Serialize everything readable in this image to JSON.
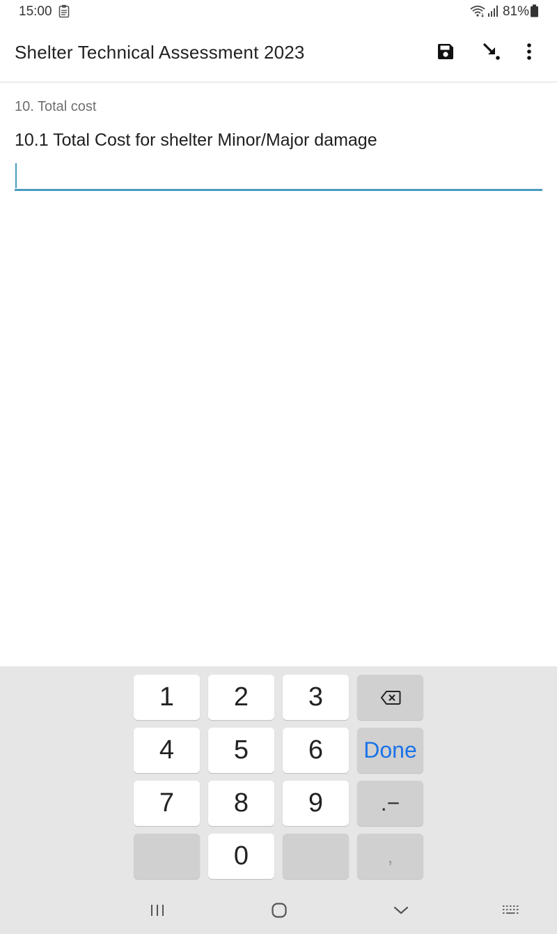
{
  "status_bar": {
    "time": "15:00",
    "battery": "81%"
  },
  "app_bar": {
    "title": "Shelter Technical Assessment 2023",
    "actions": [
      "save-icon",
      "jump-to-question-icon",
      "more-options-icon"
    ]
  },
  "form": {
    "group_label": "10. Total cost",
    "question_label": "10.1 Total Cost for shelter Minor/Major damage",
    "answer_value": ""
  },
  "keyboard": {
    "keys": {
      "k1": "1",
      "k2": "2",
      "k3": "3",
      "k4": "4",
      "k5": "5",
      "k6": "6",
      "k7": "7",
      "k8": "8",
      "k9": "9",
      "k0": "0",
      "done": "Done",
      "dot_minus": ".−",
      "comma": ","
    }
  },
  "colors": {
    "accent": "#4a9bc0",
    "done_blue": "#1a73e8",
    "keyboard_bg": "#e6e6e6",
    "fn_key_bg": "#d0d0d0"
  }
}
